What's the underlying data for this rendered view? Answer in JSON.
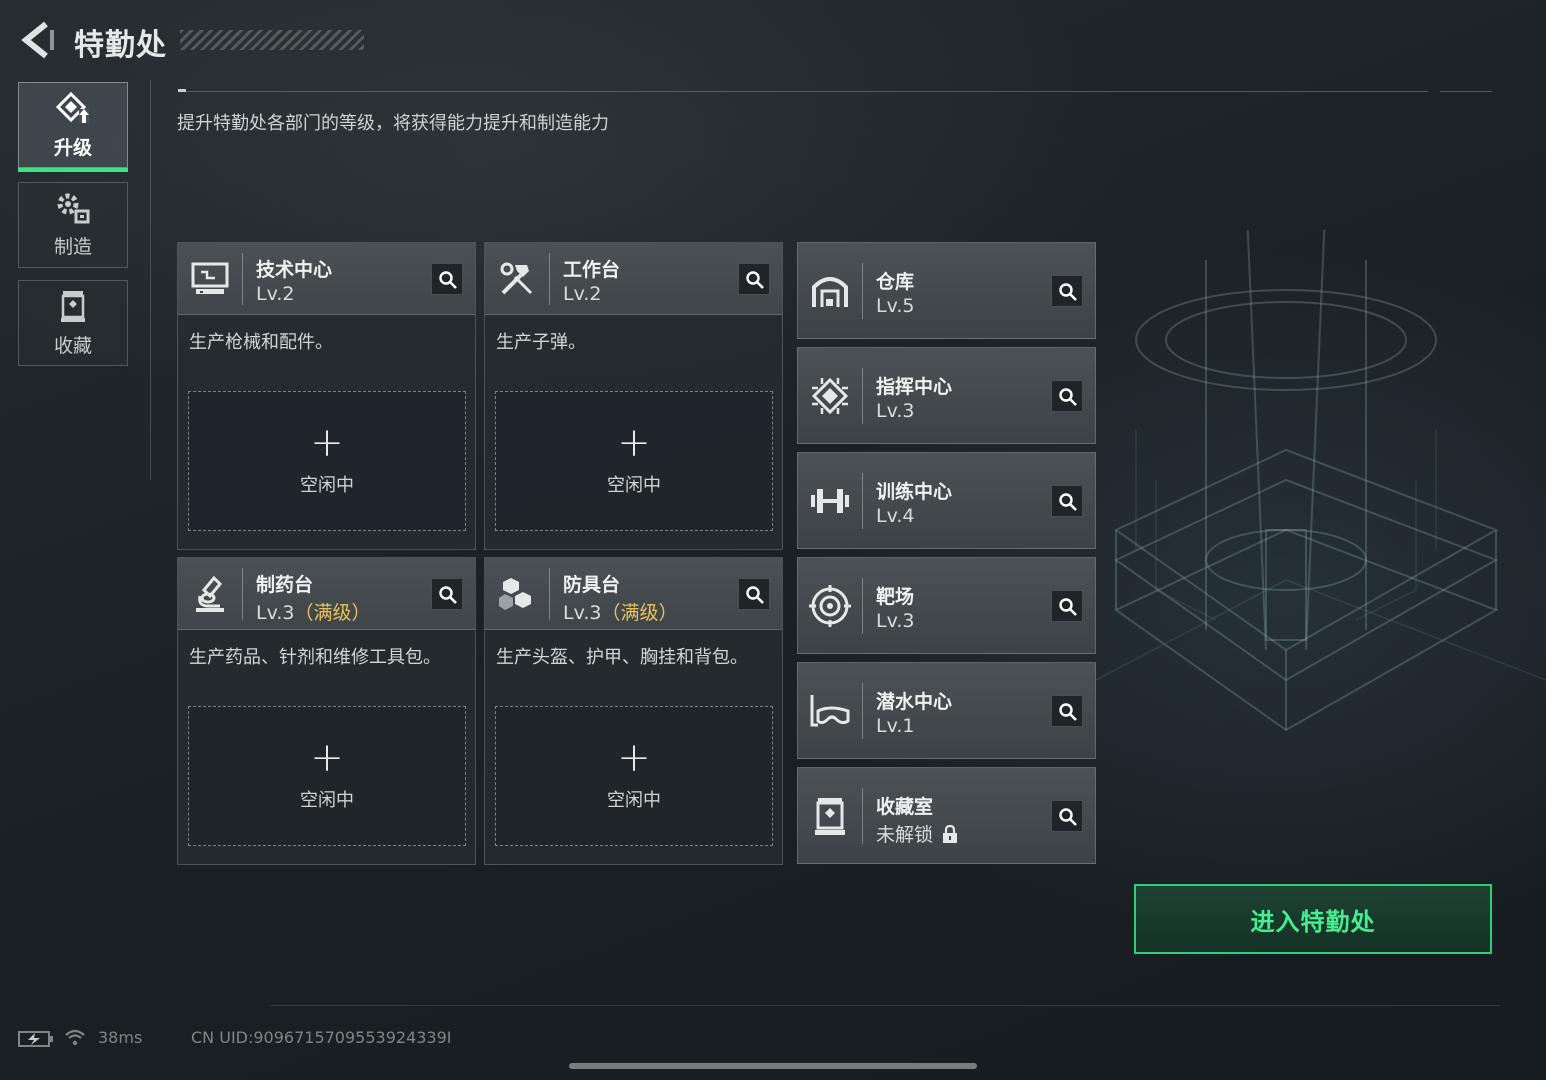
{
  "header": {
    "title": "特勤处"
  },
  "nav": [
    {
      "label": "升级",
      "icon": "upgrade-icon",
      "active": true
    },
    {
      "label": "制造",
      "icon": "gears-icon",
      "active": false
    },
    {
      "label": "收藏",
      "icon": "display-case-icon",
      "active": false
    }
  ],
  "description": "提升特勤处各部门的等级，将获得能力提升和制造能力",
  "workbenches": [
    {
      "name": "技术中心",
      "level": "Lv.2",
      "max_label": "",
      "icon": "monitor-icon",
      "desc": "生产枪械和配件。",
      "slot_state": "空闲中"
    },
    {
      "name": "工作台",
      "level": "Lv.2",
      "max_label": "",
      "icon": "hammer-wrench-icon",
      "desc": "生产子弹。",
      "slot_state": "空闲中"
    },
    {
      "name": "制药台",
      "level": "Lv.3",
      "max_label": "（满级）",
      "icon": "microscope-icon",
      "desc": "生产药品、针剂和维修工具包。",
      "slot_state": "空闲中"
    },
    {
      "name": "防具台",
      "level": "Lv.3",
      "max_label": "（满级）",
      "icon": "blocks-icon",
      "desc": "生产头盔、护甲、胸挂和背包。",
      "slot_state": "空闲中"
    }
  ],
  "facilities": [
    {
      "name": "仓库",
      "level": "Lv.5",
      "icon": "warehouse-icon"
    },
    {
      "name": "指挥中心",
      "level": "Lv.3",
      "icon": "chip-icon"
    },
    {
      "name": "训练中心",
      "level": "Lv.4",
      "icon": "dumbbell-icon"
    },
    {
      "name": "靶场",
      "level": "Lv.3",
      "icon": "target-icon"
    },
    {
      "name": "潜水中心",
      "level": "Lv.1",
      "icon": "diving-mask-icon"
    },
    {
      "name": "收藏室",
      "level": "未解锁",
      "icon": "display-case-icon",
      "locked": true
    }
  ],
  "enter_button": "进入特勤处",
  "status": {
    "ping": "38ms",
    "uid": "CN UID:9096715709553924339I"
  },
  "colors": {
    "accent": "#3fe08a",
    "max_level": "#e9c25a",
    "button_border": "#2fcf78"
  }
}
